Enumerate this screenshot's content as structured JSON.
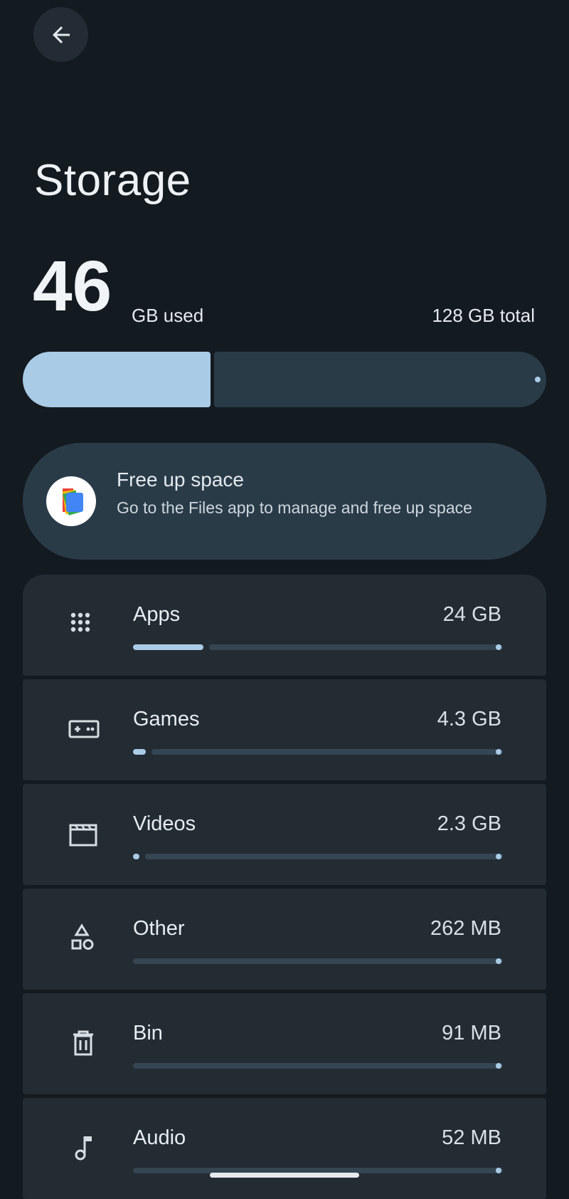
{
  "header": {
    "back_icon": "arrow-back-icon",
    "title": "Storage"
  },
  "summary": {
    "used_value": "46",
    "used_label": "GB used",
    "total_label": "128 GB total",
    "used_fraction": 0.359,
    "colors": {
      "fill": "#a9cbe6",
      "track": "#2a3b48"
    }
  },
  "free_up": {
    "icon": "files-app-icon",
    "title": "Free up space",
    "subtitle": "Go to the Files app to manage and free up space"
  },
  "categories": [
    {
      "icon": "apps-grid-icon",
      "label": "Apps",
      "size": "24 GB",
      "fraction": 0.19
    },
    {
      "icon": "gamepad-icon",
      "label": "Games",
      "size": "4.3 GB",
      "fraction": 0.034
    },
    {
      "icon": "video-clapper-icon",
      "label": "Videos",
      "size": "2.3 GB",
      "fraction": 0.018
    },
    {
      "icon": "shapes-icon",
      "label": "Other",
      "size": "262 MB",
      "fraction": 0.002
    },
    {
      "icon": "trash-icon",
      "label": "Bin",
      "size": "91 MB",
      "fraction": 0.001
    },
    {
      "icon": "music-note-icon",
      "label": "Audio",
      "size": "52 MB",
      "fraction": 0.0005
    }
  ]
}
